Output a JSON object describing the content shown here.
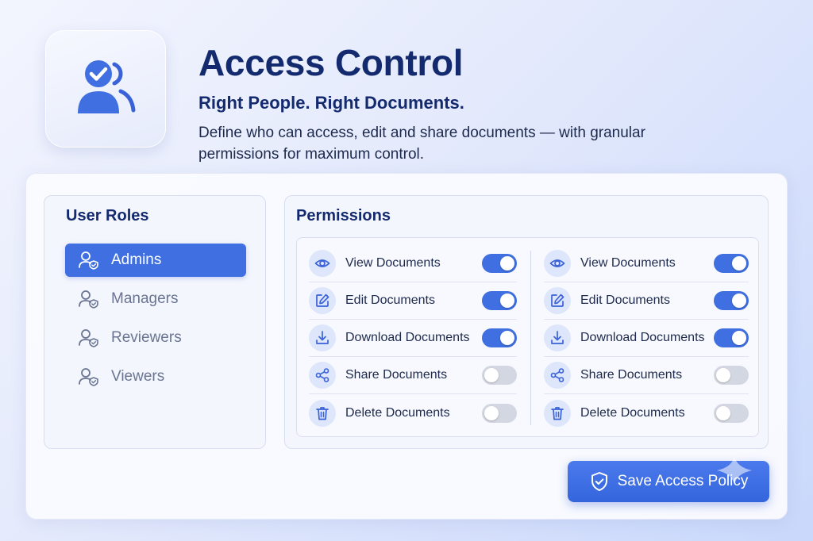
{
  "header": {
    "title": "Access Control",
    "subtitle": "Right People. Right Documents.",
    "description": "Define who can access, edit and share documents — with granular permissions for maximum control."
  },
  "hero_icon": "user-check-icon",
  "roles": {
    "title": "User Roles",
    "items": [
      {
        "label": "Admins",
        "active": true,
        "icon": "user-shield-icon"
      },
      {
        "label": "Managers",
        "active": false,
        "icon": "user-shield-icon"
      },
      {
        "label": "Reviewers",
        "active": false,
        "icon": "user-shield-icon"
      },
      {
        "label": "Viewers",
        "active": false,
        "icon": "user-shield-icon"
      }
    ]
  },
  "permissions": {
    "title": "Permissions",
    "columns": [
      {
        "rows": [
          {
            "label": "View Documents",
            "icon": "eye-icon",
            "enabled": true
          },
          {
            "label": "Edit Documents",
            "icon": "edit-icon",
            "enabled": true
          },
          {
            "label": "Download Documents",
            "icon": "download-icon",
            "enabled": true
          },
          {
            "label": "Share Documents",
            "icon": "share-icon",
            "enabled": false
          },
          {
            "label": "Delete Documents",
            "icon": "trash-icon",
            "enabled": false
          }
        ]
      },
      {
        "rows": [
          {
            "label": "View Documents",
            "icon": "eye-icon",
            "enabled": true
          },
          {
            "label": "Edit Documents",
            "icon": "edit-icon",
            "enabled": true
          },
          {
            "label": "Download Documents",
            "icon": "download-icon",
            "enabled": true
          },
          {
            "label": "Share Documents",
            "icon": "share-icon",
            "enabled": false
          },
          {
            "label": "Delete Documents",
            "icon": "trash-icon",
            "enabled": false
          }
        ]
      }
    ]
  },
  "save_button": {
    "label": "Save Access Policy",
    "icon": "shield-check-icon"
  },
  "colors": {
    "accent": "#3f6fe0",
    "title": "#142a6e",
    "toggle_off": "#d3d7e1"
  }
}
